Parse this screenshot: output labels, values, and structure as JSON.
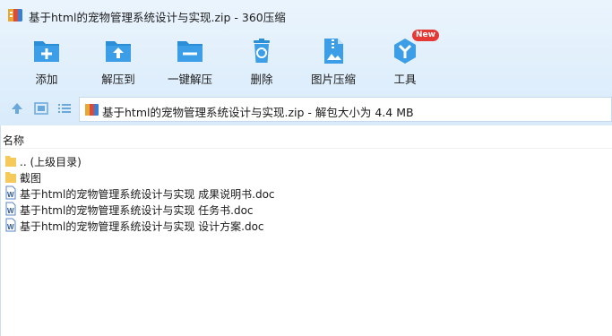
{
  "window": {
    "title": "基于html的宠物管理系统设计与实现.zip - 360压缩"
  },
  "toolbar": {
    "items": [
      {
        "label": "添加",
        "icon": "add-icon"
      },
      {
        "label": "解压到",
        "icon": "extract-to-icon"
      },
      {
        "label": "一键解压",
        "icon": "one-click-extract-icon"
      },
      {
        "label": "删除",
        "icon": "recycle-bin-icon"
      },
      {
        "label": "图片压缩",
        "icon": "image-compress-icon"
      },
      {
        "label": "工具",
        "icon": "tools-icon",
        "badge": "New"
      }
    ]
  },
  "nav": {
    "path": "基于html的宠物管理系统设计与实现.zip - 解包大小为 4.4 MB"
  },
  "filelist": {
    "column_name": "名称",
    "items": [
      {
        "name": ".. (上级目录)",
        "type": "folder"
      },
      {
        "name": "截图",
        "type": "folder"
      },
      {
        "name": "基于html的宠物管理系统设计与实现 成果说明书.doc",
        "type": "doc"
      },
      {
        "name": "基于html的宠物管理系统设计与实现 任务书.doc",
        "type": "doc"
      },
      {
        "name": "基于html的宠物管理系统设计与实现 设计方案.doc",
        "type": "doc"
      }
    ]
  },
  "colors": {
    "accent": "#2b8fd8",
    "badge": "#e53935",
    "folder": "#f5c95a"
  }
}
